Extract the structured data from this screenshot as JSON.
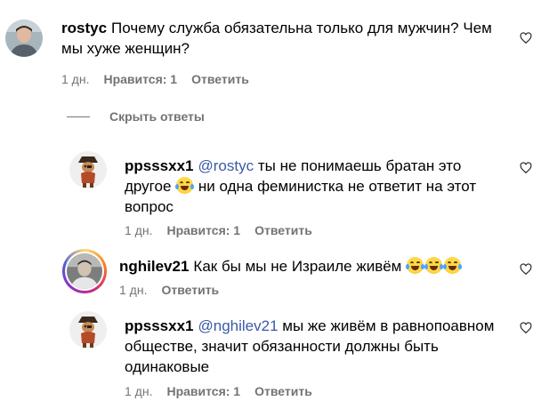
{
  "comments": [
    {
      "username": "rostyc",
      "mention": "",
      "text": "Почему служба обязательна только для мужчин? Чем мы хуже женщин?",
      "time": "1 дн.",
      "likes": "Нравится: 1",
      "reply": "Ответить",
      "avatar_icon": "user-photo-avatar"
    },
    {
      "username": "ppsssxx1",
      "mention": "@rostyc",
      "text_a": "ты не понимаешь братан это другое",
      "text_b": "ни одна феминистка не ответит на этот вопрос",
      "time": "1 дн.",
      "likes": "Нравится: 1",
      "reply": "Ответить",
      "avatar_icon": "pirate-cartoon-avatar"
    },
    {
      "username": "nghilev21",
      "mention": "",
      "text": "Как бы мы не Израиле живём",
      "time": "1 дн.",
      "likes": "",
      "reply": "Ответить",
      "avatar_icon": "user-photo-avatar"
    },
    {
      "username": "ppsssxx1",
      "mention": "@nghilev21",
      "text": "мы же живём в равнопоавном обществе, значит обязанности должны быть одинаковые",
      "time": "1 дн.",
      "likes": "Нравится: 1",
      "reply": "Ответить",
      "avatar_icon": "pirate-cartoon-avatar"
    }
  ],
  "hide_replies_label": "Скрыть ответы",
  "emoji_name": "face-with-tears-of-joy",
  "colors": {
    "mention": "#3b5aa8",
    "meta": "#737373",
    "text": "#000000"
  }
}
